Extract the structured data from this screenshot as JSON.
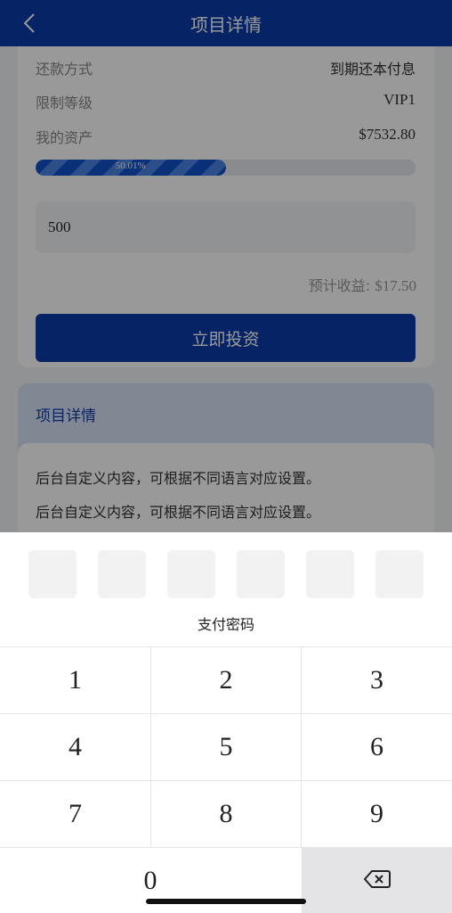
{
  "header": {
    "title": "项目详情"
  },
  "info": {
    "rows": [
      {
        "label": "还款方式",
        "value": "到期还本付息"
      },
      {
        "label": "限制等级",
        "value": "VIP1"
      },
      {
        "label": "我的资产",
        "value": "$7532.80"
      }
    ],
    "progress": {
      "percent": 50.01,
      "label": "50.01%"
    }
  },
  "invest": {
    "amount_value": "500",
    "expected_label": "预计收益:",
    "expected_value": "$17.50",
    "button_label": "立即投资"
  },
  "details": {
    "title": "项目详情",
    "lines": [
      "后台自定义内容，可根据不同语言对应设置。",
      "后台自定义内容，可根据不同语言对应设置。"
    ]
  },
  "payment": {
    "title": "支付密码",
    "pin_length": 6,
    "keys": [
      "1",
      "2",
      "3",
      "4",
      "5",
      "6",
      "7",
      "8",
      "9",
      "0"
    ]
  },
  "colors": {
    "primary": "#0b3ca8",
    "accent_light": "#d7e2f6"
  },
  "icons": {
    "back": "chevron-left-icon",
    "delete": "backspace-icon"
  }
}
